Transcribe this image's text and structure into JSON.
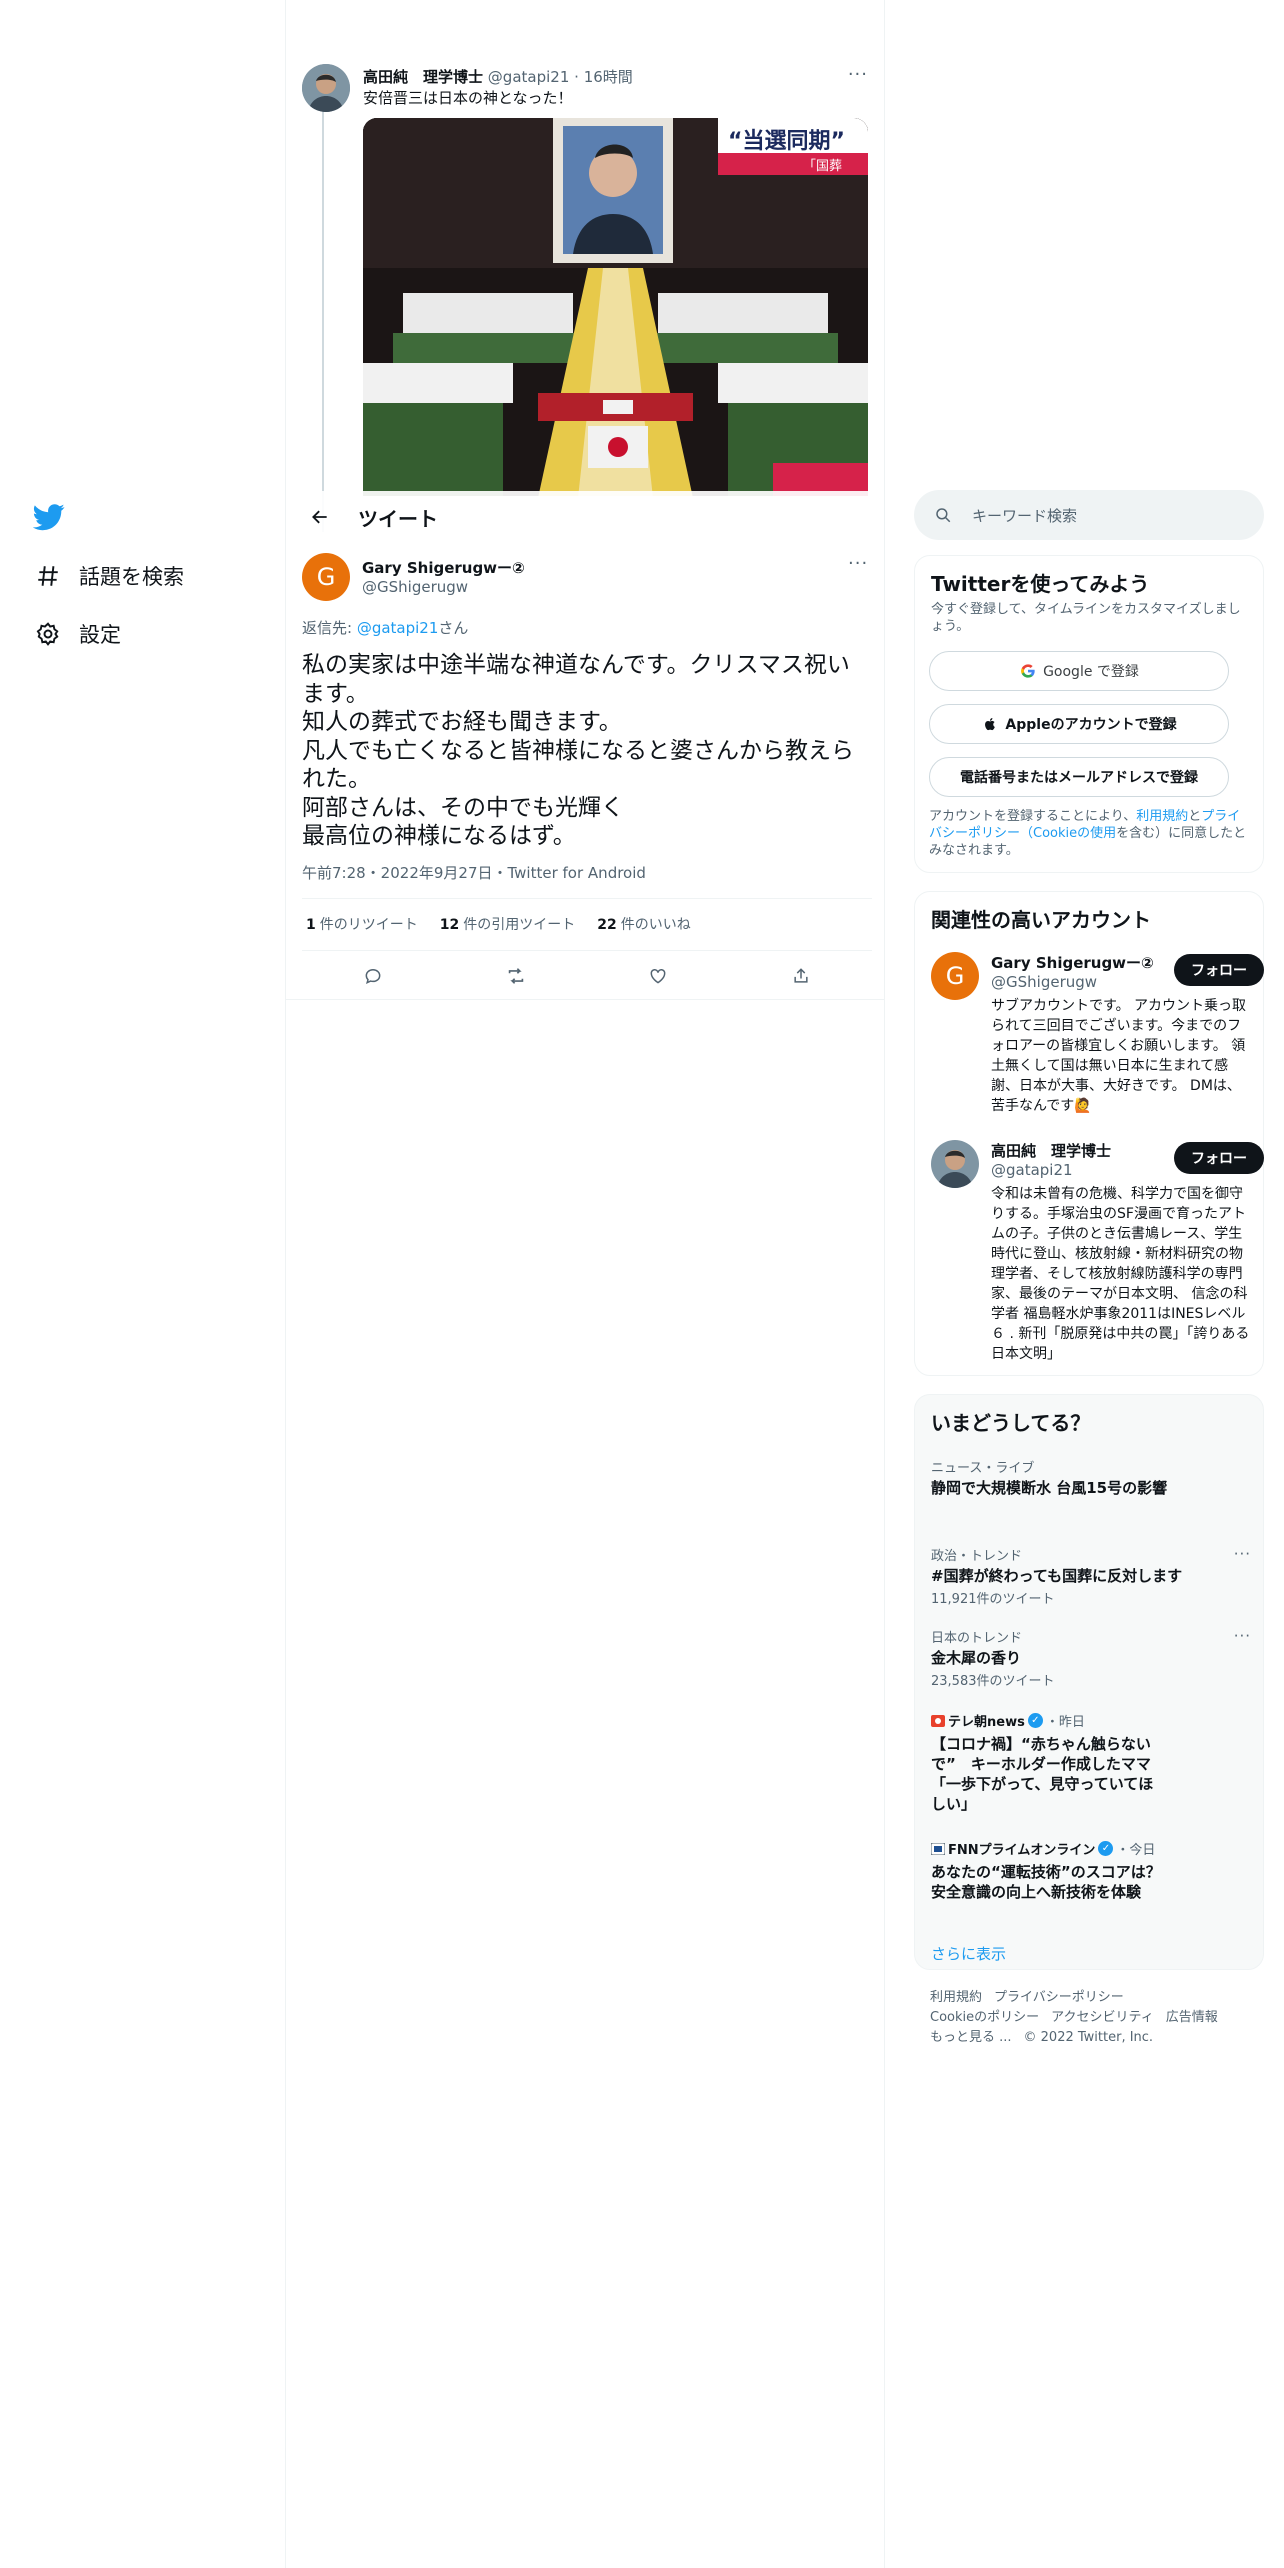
{
  "nav": {
    "items": [
      {
        "label": "話題を検索",
        "icon": "hashtag-icon"
      },
      {
        "label": "設定",
        "icon": "gear-icon"
      }
    ]
  },
  "previous_tweet": {
    "name": "高田純　理学博士",
    "handle": "@gatapi21",
    "time": "16時間",
    "text": "安倍晋三は日本の神となった！",
    "image_overlay_text": "“当選同期”",
    "image_overlay_sub": "「国葬"
  },
  "header": {
    "title": "ツイート"
  },
  "tweet": {
    "avatar_letter": "G",
    "name": "Gary Shigerugwー②",
    "handle": "@GShigerugw",
    "reply_prefix": "返信先: ",
    "reply_link": "@gatapi21",
    "reply_suffix": "さん",
    "text": "私の実家は中途半端な神道なんです。クリスマス祝います。\n知人の葬式でお経も聞きます。\n凡人でも亡くなると皆神様になると婆さんから教えられた。\n阿部さんは、その中でも光輝く\n最高位の神様になるはず。",
    "meta": "午前7:28・2022年9月27日・Twitter for Android",
    "stats": [
      {
        "count": "1",
        "label": "件のリツイート"
      },
      {
        "count": "12",
        "label": "件の引用ツイート"
      },
      {
        "count": "22",
        "label": "件のいいね"
      }
    ]
  },
  "search": {
    "placeholder": "キーワード検索"
  },
  "signup": {
    "title": "Twitterを使ってみよう",
    "subtitle": "今すぐ登録して、タイムラインをカスタマイズしましょう。",
    "google_button": "Google で登録",
    "apple_button": "Appleのアカウントで登録",
    "phone_button": "電話番号またはメールアドレスで登録",
    "terms_pre": "アカウントを登録することにより、",
    "terms_link1": "利用規約",
    "terms_mid": "と",
    "terms_link2": "プライバシーポリシー（Cookieの使用",
    "terms_post": "を含む）に同意したとみなされます。"
  },
  "related": {
    "title": "関連性の高いアカウント",
    "follow_label": "フォロー",
    "accounts": [
      {
        "avatar_letter": "G",
        "name": "Gary Shigerugwー②",
        "handle": "@GShigerugw",
        "bio": "サブアカウントです。 アカウント乗っ取られて三回目でございます。今までのフォロアーの皆様宜しくお願いします。 領土無くして国は無い日本に生まれて感謝、日本が大事、大好きです。 DMは、苦手なんです🙋"
      },
      {
        "name": "高田純　理学博士",
        "handle": "@gatapi21",
        "bio": "令和は未曾有の危機、科学力で国を御守りする。手塚治虫のSF漫画で育ったアトムの子。子供のとき伝書鳩レース、学生時代に登山、核放射線・新材料研究の物理学者、そして核放射線防護科学の専門家、最後のテーマが日本文明、 信念の科学者 福島軽水炉事象2011はINESレベル６ . 新刊「脱原発は中共の罠」「誇りある日本文明」"
      }
    ]
  },
  "trends": {
    "title": "いまどうしてる？",
    "items": [
      {
        "category": "ニュース・ライブ",
        "title": "静岡で大規模断水 台風15号の影響"
      },
      {
        "category": "政治・トレンド",
        "title": "#国葬が終わっても国葬に反対します",
        "count": "11,921件のツイート"
      },
      {
        "category": "日本のトレンド",
        "title": "金木犀の香り",
        "count": "23,583件のツイート"
      }
    ],
    "news": [
      {
        "source": "テレ朝news",
        "time": "・昨日",
        "headline": "【コロナ禍】“赤ちゃん触らないで”　キーホルダー作成したママ「一歩下がって、見守っていてほしい」"
      },
      {
        "source": "FNNプライムオンライン",
        "time": "・今日",
        "headline": "あなたの“運転技術”のスコアは？ 安全意識の向上へ新技術を体験"
      }
    ],
    "show_more": "さらに表示"
  },
  "footer": {
    "links": [
      "利用規約",
      "プライバシーポリシー",
      "Cookieのポリシー",
      "アクセシビリティ",
      "広告情報",
      "もっと見る ..."
    ],
    "copyright": "© 2022 Twitter, Inc."
  },
  "colors": {
    "accent": "#1d9bf0",
    "text": "#0f1419",
    "secondary": "#536471",
    "avatar_orange": "#e8710a"
  }
}
